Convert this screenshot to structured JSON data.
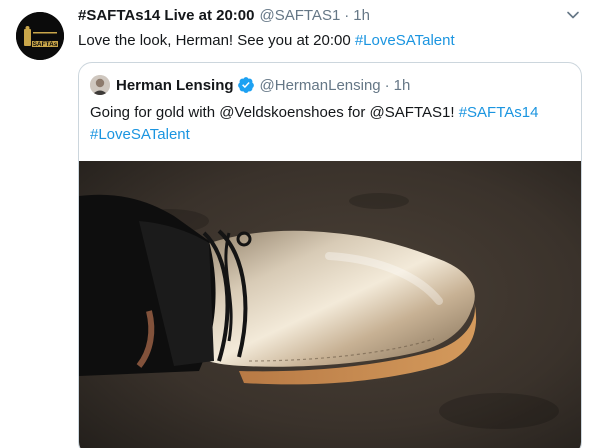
{
  "tweet": {
    "author_name": "#SAFTAs14 Live at 20:00",
    "author_handle": "@SAFTAS1",
    "separator": "·",
    "time": "1h",
    "text_prefix": "Love the look, Herman! See you at 20:00 ",
    "text_hashtag": "#LoveSATalent",
    "avatar_logo_text": "SAFTAs"
  },
  "quoted": {
    "author_name": "Herman Lensing",
    "author_handle": "@HermanLensing",
    "separator": "·",
    "time": "1h",
    "text_line1_prefix": "Going for gold with @Veldskoenshoes for @SAFTAS1! ",
    "text_line1_hashtag": "#SAFTAs14",
    "text_line2_hashtag": "#LoveSATalent"
  },
  "icons": {
    "chevron": "chevron-down-icon",
    "verified": "verified-badge-icon"
  },
  "colors": {
    "link": "#1b95e0",
    "verified": "#1da1f2",
    "secondary_text": "#657786",
    "border": "#ccd6dd"
  }
}
